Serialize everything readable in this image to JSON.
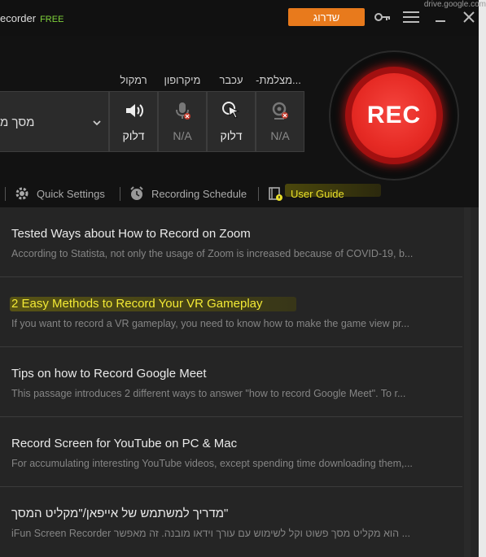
{
  "window": {
    "title": "ecorder",
    "edition": "FREE",
    "upgrade_label": "שדרוג",
    "url_ghost": "drive.google.com"
  },
  "devices": {
    "screen_source": "מסך מ",
    "items": [
      {
        "label": "רמקול",
        "status": "דלוק",
        "icon": "speaker-icon"
      },
      {
        "label": "מיקרופון",
        "status": "N/A",
        "icon": "microphone-icon"
      },
      {
        "label": "עכבר",
        "status": "דלוק",
        "icon": "mouse-click-icon"
      },
      {
        "label": "-מצלמת...",
        "status": "N/A",
        "icon": "webcam-icon"
      }
    ]
  },
  "rec_button": {
    "label": "REC"
  },
  "toolbar": {
    "quick_settings": "Quick Settings",
    "recording_schedule": "Recording Schedule",
    "user_guide": "User Guide"
  },
  "articles": [
    {
      "title": "Tested Ways about How to Record on Zoom",
      "desc": "According to Statista, not only the usage of Zoom is increased because of COVID-19, b..."
    },
    {
      "title": "2 Easy Methods to Record Your VR Gameplay",
      "desc": "If you want to record a VR gameplay, you need to know how to make the game view pr..."
    },
    {
      "title": "Tips on how to Record Google Meet",
      "desc": "This passage introduces 2 different ways to answer \"how to record Google Meet\". To r..."
    },
    {
      "title": "Record Screen for YouTube on PC & Mac",
      "desc": "For accumulating interesting YouTube videos, except spending time downloading them,..."
    },
    {
      "title": "\"מדריך למשתמש של אייפאן/\"מקליט המסך",
      "desc": "iFun Screen Recorder הוא מקליט מסך פשוט וקל לשימוש עם עורך וידאו מובנה. זה מאפשר ..."
    }
  ],
  "colors": {
    "accent_orange": "#e87a1c",
    "rec_red": "#e62a24",
    "free_green": "#7fd13b",
    "highlight_yellow": "#f3ea35"
  }
}
